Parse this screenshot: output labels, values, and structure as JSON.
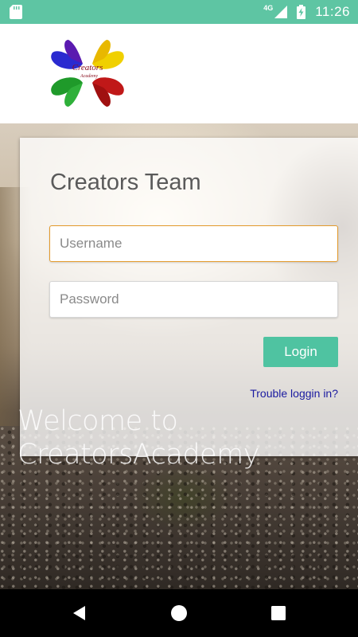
{
  "status_bar": {
    "network_type": "4G",
    "time": "11:26",
    "icons": [
      "sd-card-icon",
      "signal-icon",
      "battery-charging-icon"
    ]
  },
  "header": {
    "logo_text": "Creators",
    "logo_subtext": "Academy"
  },
  "login_card": {
    "title": "Creators Team",
    "username_placeholder": "Username",
    "password_placeholder": "Password",
    "login_label": "Login",
    "trouble_link": "Trouble loggin in?"
  },
  "welcome": {
    "line1": "Welcome to",
    "line2": "CreatorsAcademy"
  },
  "nav_bar": {
    "icons": [
      "back-icon",
      "home-icon",
      "recents-icon"
    ]
  },
  "colors": {
    "accent": "#5ec5a3",
    "button": "#4fc3a1",
    "focus_border": "#e39a2b",
    "link": "#1a1aa0"
  }
}
